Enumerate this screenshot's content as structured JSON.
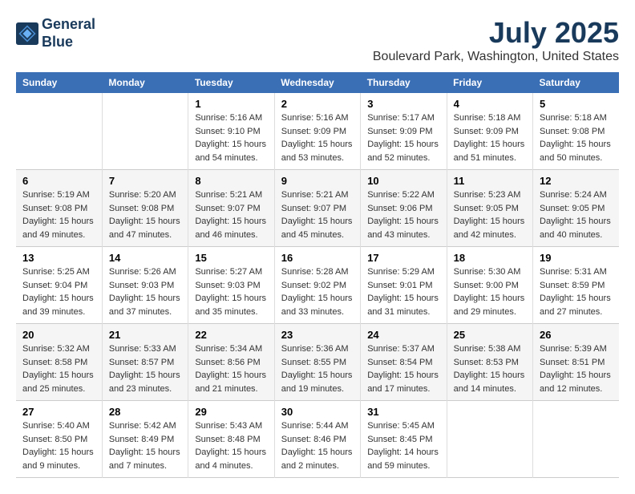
{
  "header": {
    "logo_line1": "General",
    "logo_line2": "Blue",
    "month": "July 2025",
    "location": "Boulevard Park, Washington, United States"
  },
  "weekdays": [
    "Sunday",
    "Monday",
    "Tuesday",
    "Wednesday",
    "Thursday",
    "Friday",
    "Saturday"
  ],
  "weeks": [
    [
      {
        "day": "",
        "info": ""
      },
      {
        "day": "",
        "info": ""
      },
      {
        "day": "1",
        "info": "Sunrise: 5:16 AM\nSunset: 9:10 PM\nDaylight: 15 hours and 54 minutes."
      },
      {
        "day": "2",
        "info": "Sunrise: 5:16 AM\nSunset: 9:09 PM\nDaylight: 15 hours and 53 minutes."
      },
      {
        "day": "3",
        "info": "Sunrise: 5:17 AM\nSunset: 9:09 PM\nDaylight: 15 hours and 52 minutes."
      },
      {
        "day": "4",
        "info": "Sunrise: 5:18 AM\nSunset: 9:09 PM\nDaylight: 15 hours and 51 minutes."
      },
      {
        "day": "5",
        "info": "Sunrise: 5:18 AM\nSunset: 9:08 PM\nDaylight: 15 hours and 50 minutes."
      }
    ],
    [
      {
        "day": "6",
        "info": "Sunrise: 5:19 AM\nSunset: 9:08 PM\nDaylight: 15 hours and 49 minutes."
      },
      {
        "day": "7",
        "info": "Sunrise: 5:20 AM\nSunset: 9:08 PM\nDaylight: 15 hours and 47 minutes."
      },
      {
        "day": "8",
        "info": "Sunrise: 5:21 AM\nSunset: 9:07 PM\nDaylight: 15 hours and 46 minutes."
      },
      {
        "day": "9",
        "info": "Sunrise: 5:21 AM\nSunset: 9:07 PM\nDaylight: 15 hours and 45 minutes."
      },
      {
        "day": "10",
        "info": "Sunrise: 5:22 AM\nSunset: 9:06 PM\nDaylight: 15 hours and 43 minutes."
      },
      {
        "day": "11",
        "info": "Sunrise: 5:23 AM\nSunset: 9:05 PM\nDaylight: 15 hours and 42 minutes."
      },
      {
        "day": "12",
        "info": "Sunrise: 5:24 AM\nSunset: 9:05 PM\nDaylight: 15 hours and 40 minutes."
      }
    ],
    [
      {
        "day": "13",
        "info": "Sunrise: 5:25 AM\nSunset: 9:04 PM\nDaylight: 15 hours and 39 minutes."
      },
      {
        "day": "14",
        "info": "Sunrise: 5:26 AM\nSunset: 9:03 PM\nDaylight: 15 hours and 37 minutes."
      },
      {
        "day": "15",
        "info": "Sunrise: 5:27 AM\nSunset: 9:03 PM\nDaylight: 15 hours and 35 minutes."
      },
      {
        "day": "16",
        "info": "Sunrise: 5:28 AM\nSunset: 9:02 PM\nDaylight: 15 hours and 33 minutes."
      },
      {
        "day": "17",
        "info": "Sunrise: 5:29 AM\nSunset: 9:01 PM\nDaylight: 15 hours and 31 minutes."
      },
      {
        "day": "18",
        "info": "Sunrise: 5:30 AM\nSunset: 9:00 PM\nDaylight: 15 hours and 29 minutes."
      },
      {
        "day": "19",
        "info": "Sunrise: 5:31 AM\nSunset: 8:59 PM\nDaylight: 15 hours and 27 minutes."
      }
    ],
    [
      {
        "day": "20",
        "info": "Sunrise: 5:32 AM\nSunset: 8:58 PM\nDaylight: 15 hours and 25 minutes."
      },
      {
        "day": "21",
        "info": "Sunrise: 5:33 AM\nSunset: 8:57 PM\nDaylight: 15 hours and 23 minutes."
      },
      {
        "day": "22",
        "info": "Sunrise: 5:34 AM\nSunset: 8:56 PM\nDaylight: 15 hours and 21 minutes."
      },
      {
        "day": "23",
        "info": "Sunrise: 5:36 AM\nSunset: 8:55 PM\nDaylight: 15 hours and 19 minutes."
      },
      {
        "day": "24",
        "info": "Sunrise: 5:37 AM\nSunset: 8:54 PM\nDaylight: 15 hours and 17 minutes."
      },
      {
        "day": "25",
        "info": "Sunrise: 5:38 AM\nSunset: 8:53 PM\nDaylight: 15 hours and 14 minutes."
      },
      {
        "day": "26",
        "info": "Sunrise: 5:39 AM\nSunset: 8:51 PM\nDaylight: 15 hours and 12 minutes."
      }
    ],
    [
      {
        "day": "27",
        "info": "Sunrise: 5:40 AM\nSunset: 8:50 PM\nDaylight: 15 hours and 9 minutes."
      },
      {
        "day": "28",
        "info": "Sunrise: 5:42 AM\nSunset: 8:49 PM\nDaylight: 15 hours and 7 minutes."
      },
      {
        "day": "29",
        "info": "Sunrise: 5:43 AM\nSunset: 8:48 PM\nDaylight: 15 hours and 4 minutes."
      },
      {
        "day": "30",
        "info": "Sunrise: 5:44 AM\nSunset: 8:46 PM\nDaylight: 15 hours and 2 minutes."
      },
      {
        "day": "31",
        "info": "Sunrise: 5:45 AM\nSunset: 8:45 PM\nDaylight: 14 hours and 59 minutes."
      },
      {
        "day": "",
        "info": ""
      },
      {
        "day": "",
        "info": ""
      }
    ]
  ]
}
